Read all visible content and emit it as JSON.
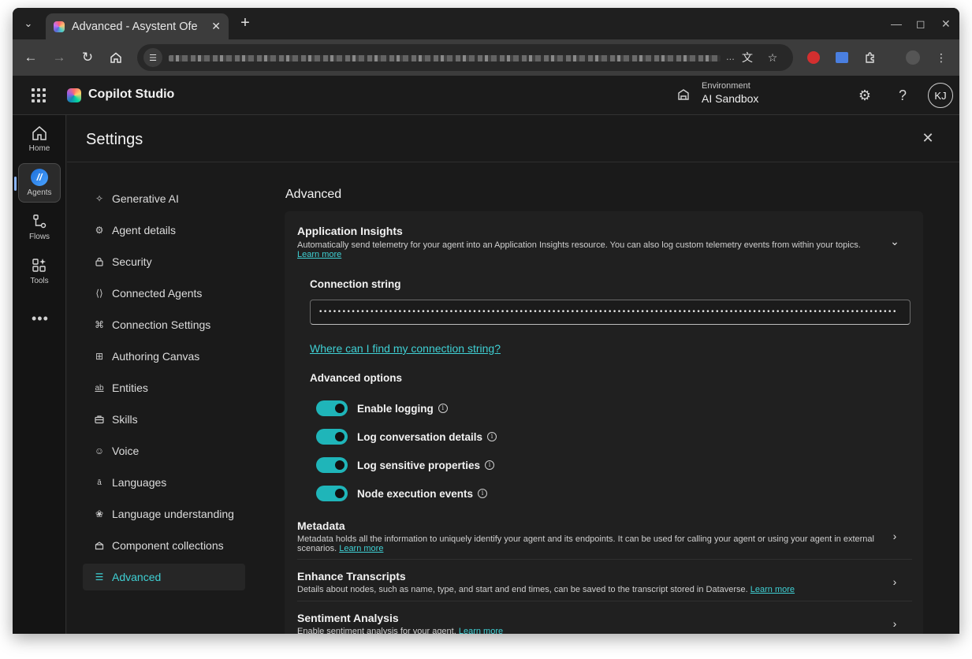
{
  "browser": {
    "tab_title": "Advanced - Asystent Ofe",
    "new_tab": "+",
    "url_ellipsis": "..."
  },
  "app": {
    "name": "Copilot Studio",
    "environment_label": "Environment",
    "environment_value": "AI Sandbox",
    "avatar_initials": "KJ"
  },
  "rail": {
    "items": [
      {
        "label": "Home"
      },
      {
        "label": "Agents"
      },
      {
        "label": "Flows"
      },
      {
        "label": "Tools"
      }
    ]
  },
  "settings": {
    "title": "Settings",
    "nav": [
      {
        "label": "Generative AI",
        "icon": "sparkle-icon"
      },
      {
        "label": "Agent details",
        "icon": "gear-icon"
      },
      {
        "label": "Security",
        "icon": "lock-icon"
      },
      {
        "label": "Connected Agents",
        "icon": "code-icon"
      },
      {
        "label": "Connection Settings",
        "icon": "network-icon"
      },
      {
        "label": "Authoring Canvas",
        "icon": "grid-icon"
      },
      {
        "label": "Entities",
        "icon": "abc-icon"
      },
      {
        "label": "Skills",
        "icon": "briefcase-icon"
      },
      {
        "label": "Voice",
        "icon": "voice-icon"
      },
      {
        "label": "Languages",
        "icon": "translate-icon"
      },
      {
        "label": "Language understanding",
        "icon": "brain-icon"
      },
      {
        "label": "Component collections",
        "icon": "box-icon"
      },
      {
        "label": "Advanced",
        "icon": "sliders-icon"
      }
    ],
    "active_nav": "Advanced"
  },
  "advanced": {
    "section_title": "Advanced",
    "app_insights": {
      "title": "Application Insights",
      "desc": "Automatically send telemetry for your agent into an Application Insights resource. You can also log custom telemetry events from within your topics.",
      "learn_more": "Learn more",
      "connection_label": "Connection string",
      "connection_value": "••••••••••••••••••••••••••••••••••••••••••••••••••••••••••••••••••••••••••••••••••••••••••••••••••••••••••••••••••••••••••••",
      "help_link": "Where can I find my connection string?",
      "advanced_options_label": "Advanced options",
      "toggles": [
        {
          "label": "Enable logging",
          "on": true
        },
        {
          "label": "Log conversation details",
          "on": true
        },
        {
          "label": "Log sensitive properties",
          "on": true
        },
        {
          "label": "Node execution events",
          "on": true
        }
      ]
    },
    "metadata": {
      "title": "Metadata",
      "desc": "Metadata holds all the information to uniquely identify your agent and its endpoints. It can be used for calling your agent or using your agent in external scenarios.",
      "learn_more": "Learn more"
    },
    "transcripts": {
      "title": "Enhance Transcripts",
      "desc": "Details about nodes, such as name, type, and start and end times, can be saved to the transcript stored in Dataverse.",
      "learn_more": "Learn more"
    },
    "sentiment": {
      "title": "Sentiment Analysis",
      "desc": "Enable sentiment analysis for your agent.",
      "learn_more": "Learn more"
    }
  },
  "colors": {
    "accent": "#3fd0d4",
    "toggle_on": "#1fb5b9",
    "background": "#1a1a1a"
  }
}
